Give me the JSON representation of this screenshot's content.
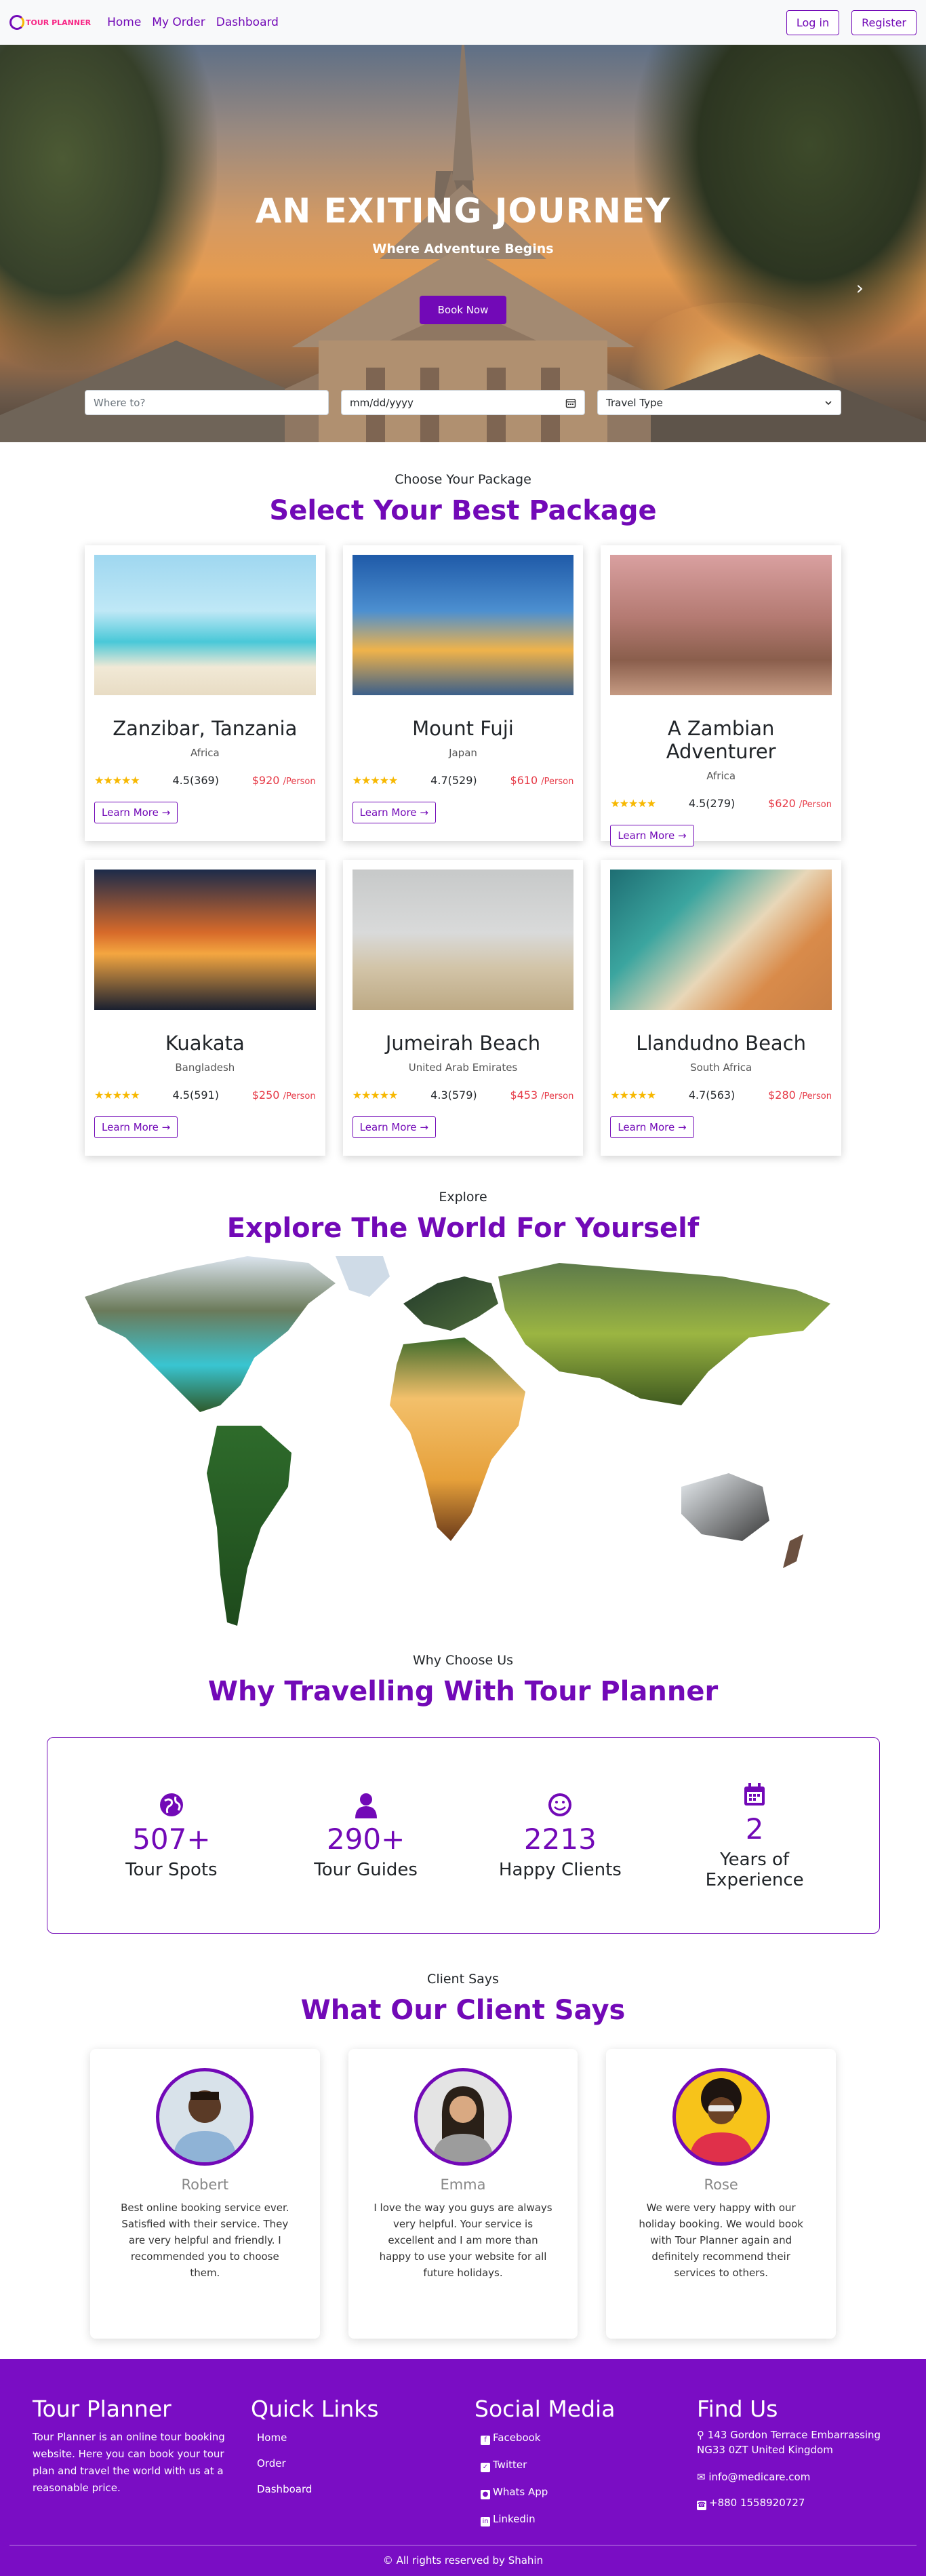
{
  "brand": {
    "name": "TOUR PLANNER"
  },
  "nav": {
    "links": [
      "Home",
      "My Order",
      "Dashboard"
    ],
    "login": "Log in",
    "register": "Register"
  },
  "hero": {
    "title": "AN EXITING JOURNEY",
    "subtitle": "Where Adventure Begins",
    "cta": "Book Now",
    "next_arrow": "›",
    "search": {
      "where_placeholder": "Where to?",
      "date_placeholder": "mm/dd/yyyy",
      "type_value": "Travel Type"
    }
  },
  "packages": {
    "kicker": "Choose Your Package",
    "title": "Select Your Best Package",
    "learn_more": "Learn More",
    "items": [
      {
        "name": "Zanzibar, Tanzania",
        "region": "Africa",
        "rating": "4.5(369)",
        "price": "$920",
        "unit": "/Person"
      },
      {
        "name": "Mount Fuji",
        "region": "Japan",
        "rating": "4.7(529)",
        "price": "$610",
        "unit": "/Person"
      },
      {
        "name": "A Zambian Adventurer",
        "region": "Africa",
        "rating": "4.5(279)",
        "price": "$620",
        "unit": "/Person"
      },
      {
        "name": "Kuakata",
        "region": "Bangladesh",
        "rating": "4.5(591)",
        "price": "$250",
        "unit": "/Person"
      },
      {
        "name": "Jumeirah Beach",
        "region": "United Arab Emirates",
        "rating": "4.3(579)",
        "price": "$453",
        "unit": "/Person"
      },
      {
        "name": "Llandudno Beach",
        "region": "South Africa",
        "rating": "4.7(563)",
        "price": "$280",
        "unit": "/Person"
      }
    ]
  },
  "explore": {
    "kicker": "Explore",
    "title": "Explore The World For Yourself"
  },
  "why": {
    "kicker": "Why Choose Us",
    "title": "Why Travelling With Tour Planner",
    "stats": [
      {
        "value": "507+",
        "label": "Tour Spots",
        "icon": "globe-icon"
      },
      {
        "value": "290+",
        "label": "Tour Guides",
        "icon": "user-icon"
      },
      {
        "value": "2213",
        "label": "Happy Clients",
        "icon": "smile-icon"
      },
      {
        "value": "2",
        "label": "Years of Experience",
        "icon": "calendar-icon"
      }
    ]
  },
  "clients": {
    "kicker": "Client Says",
    "title": "What Our Client Says",
    "items": [
      {
        "name": "Robert",
        "quote": "Best online booking service ever. Satisfied with their service. They are very helpful and friendly. I recommended you to choose them."
      },
      {
        "name": "Emma",
        "quote": "I love the way you guys are always very helpful. Your service is excellent and I am more than happy to use your website for all future holidays."
      },
      {
        "name": "Rose",
        "quote": "We were very happy with our holiday booking. We would book with Tour Planner again and definitely recommend their services to others."
      }
    ]
  },
  "footer": {
    "about_title": "Tour Planner",
    "about_text": "Tour Planner is an online tour booking website. Here you can book your tour plan and travel the world with us at a reasonable price.",
    "links_title": "Quick Links",
    "links": [
      "Home",
      "Order",
      "Dashboard"
    ],
    "social_title": "Social Media",
    "social": [
      "Facebook",
      "Twitter",
      "Whats App",
      "Linkedin"
    ],
    "find_title": "Find Us",
    "address": "143 Gordon Terrace Embarrassing NG33 0ZT United Kingdom",
    "email": "info@medicare.com",
    "phone": "+880 1558920727",
    "copyright": "All rights reserved by Shahin"
  },
  "colors": {
    "accent": "#7209b7",
    "price": "#e63946",
    "star": "#f7b801",
    "footer_bg": "#7a0dc4"
  }
}
